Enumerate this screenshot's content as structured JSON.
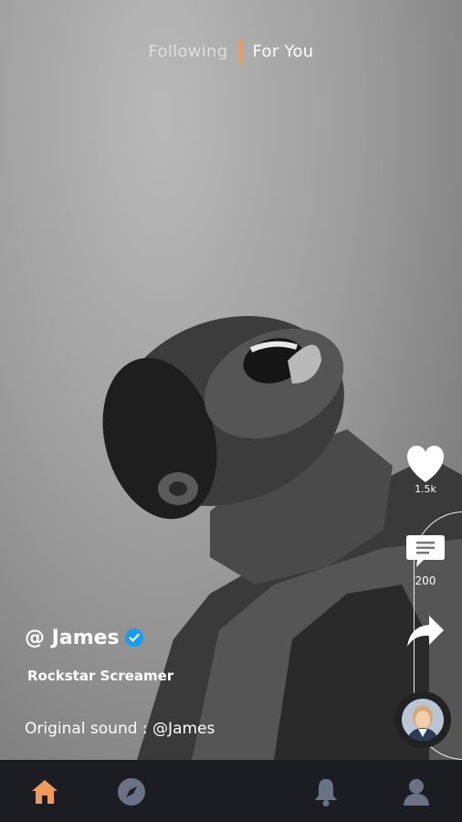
{
  "top_tabs": {
    "following": "Following",
    "for_you": "For You"
  },
  "video": {
    "username": "@ James",
    "subtitle": "Rockstar Screamer",
    "sound": "Original sound : @James"
  },
  "actions": {
    "likes": "1.5k",
    "comments": "200"
  },
  "nav": {
    "items": [
      "home-icon",
      "compass-icon",
      "bell-icon",
      "profile-icon"
    ],
    "active": "home-icon"
  },
  "colors": {
    "accent": "#ef9a5d",
    "nav_bg": "#1b1d22",
    "nav_icon": "#6b7284",
    "verified": "#1d9bf0"
  }
}
